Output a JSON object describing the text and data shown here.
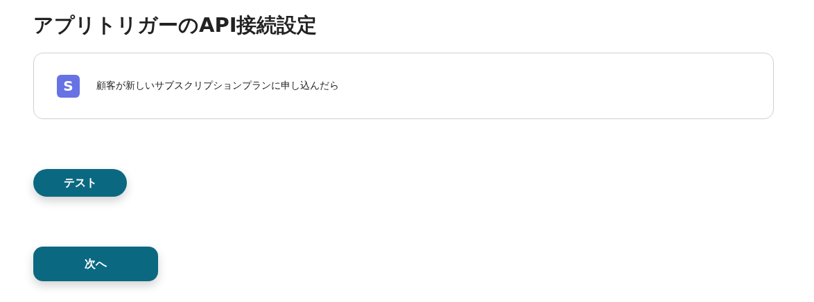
{
  "title": "アプリトリガーのAPI接続設定",
  "trigger": {
    "icon_letter": "S",
    "label": "顧客が新しいサブスクリプションプランに申し込んだら"
  },
  "buttons": [
    {
      "kind": "pill",
      "label": "テスト"
    },
    {
      "kind": "primary",
      "label": "次へ"
    }
  ]
}
